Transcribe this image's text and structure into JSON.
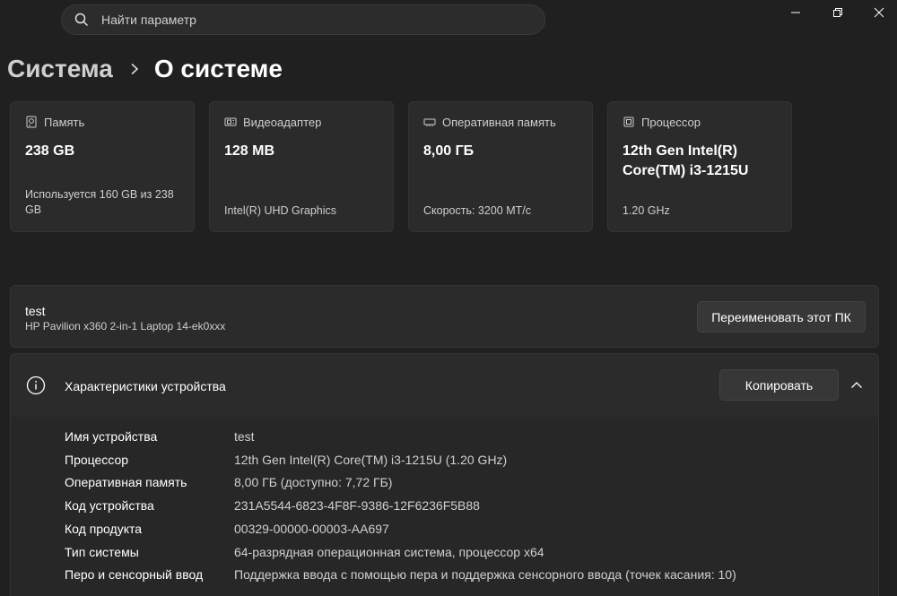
{
  "search": {
    "placeholder": "Найти параметр"
  },
  "breadcrumb": {
    "parent": "Система",
    "current": "О системе"
  },
  "cards": [
    {
      "icon": "storage-icon",
      "label": "Память",
      "value": "238 GB",
      "sub": "Используется 160 GB из 238 GB"
    },
    {
      "icon": "gpu-icon",
      "label": "Видеоадаптер",
      "value": "128 MB",
      "sub": "Intel(R) UHD Graphics"
    },
    {
      "icon": "ram-icon",
      "label": "Оперативная память",
      "value": "8,00 ГБ",
      "sub": "Скорость: 3200 МТ/с"
    },
    {
      "icon": "cpu-icon",
      "label": "Процессор",
      "value": "12th Gen Intel(R) Core(TM) i3-1215U",
      "sub": "1.20 GHz"
    }
  ],
  "device": {
    "name": "test",
    "model": "HP Pavilion x360 2-in-1 Laptop 14-ek0xxx",
    "rename_label": "Переименовать этот ПК"
  },
  "specs": {
    "title": "Характеристики устройства",
    "copy_label": "Копировать",
    "rows": [
      {
        "key": "Имя устройства",
        "value": "test"
      },
      {
        "key": "Процессор",
        "value": "12th Gen Intel(R) Core(TM) i3-1215U (1.20 GHz)"
      },
      {
        "key": "Оперативная память",
        "value": "8,00 ГБ (доступно: 7,72 ГБ)"
      },
      {
        "key": "Код устройства",
        "value": "231A5544-6823-4F8F-9386-12F6236F5B88"
      },
      {
        "key": "Код продукта",
        "value": "00329-00000-00003-AA697"
      },
      {
        "key": "Тип системы",
        "value": "64-разрядная операционная система, процессор x64"
      },
      {
        "key": "Перо и сенсорный ввод",
        "value": "Поддержка ввода с помощью пера и поддержка сенсорного ввода (точек касания: 10)"
      }
    ]
  }
}
